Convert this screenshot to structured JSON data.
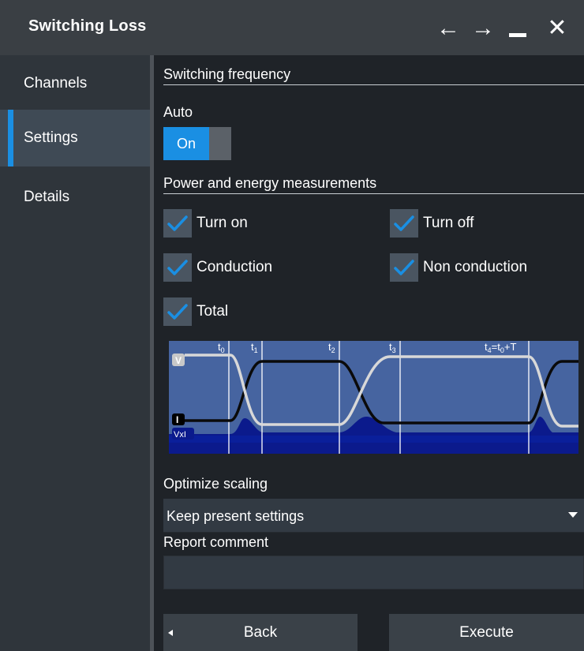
{
  "window": {
    "title": "Switching Loss",
    "controls": [
      "arrow-left-icon",
      "arrow-right-icon",
      "minimize-icon",
      "close-icon"
    ]
  },
  "sidebar": {
    "items": [
      {
        "label": "Channels",
        "active": false
      },
      {
        "label": "Settings",
        "active": true
      },
      {
        "label": "Details",
        "active": false
      }
    ]
  },
  "settings": {
    "switching_frequency": {
      "heading": "Switching frequency",
      "auto_label": "Auto",
      "auto_toggle": "On"
    },
    "power_energy": {
      "heading": "Power and energy measurements",
      "checkboxes": [
        {
          "label": "Turn on",
          "checked": true
        },
        {
          "label": "Turn off",
          "checked": true
        },
        {
          "label": "Conduction",
          "checked": true
        },
        {
          "label": "Non conduction",
          "checked": true
        },
        {
          "label": "Total",
          "checked": true
        }
      ]
    },
    "diagram": {
      "markers": [
        "t0",
        "t1",
        "t2",
        "t3",
        "t4=t0+T"
      ],
      "trace_labels": {
        "voltage": "V",
        "current": "I",
        "power": "VxI"
      }
    },
    "optimize_scaling": {
      "label": "Optimize scaling",
      "selected": "Keep present settings"
    },
    "report_comment": {
      "label": "Report comment",
      "value": ""
    }
  },
  "buttons": {
    "back": "Back",
    "execute": "Execute"
  },
  "colors": {
    "accent": "#1a8fe3",
    "background": "#1f2328",
    "titlebar": "#3a3f44",
    "sidebar": "#2f353b",
    "diagram_bg": "#4664a0",
    "power_fill": "#0b1a8c"
  }
}
